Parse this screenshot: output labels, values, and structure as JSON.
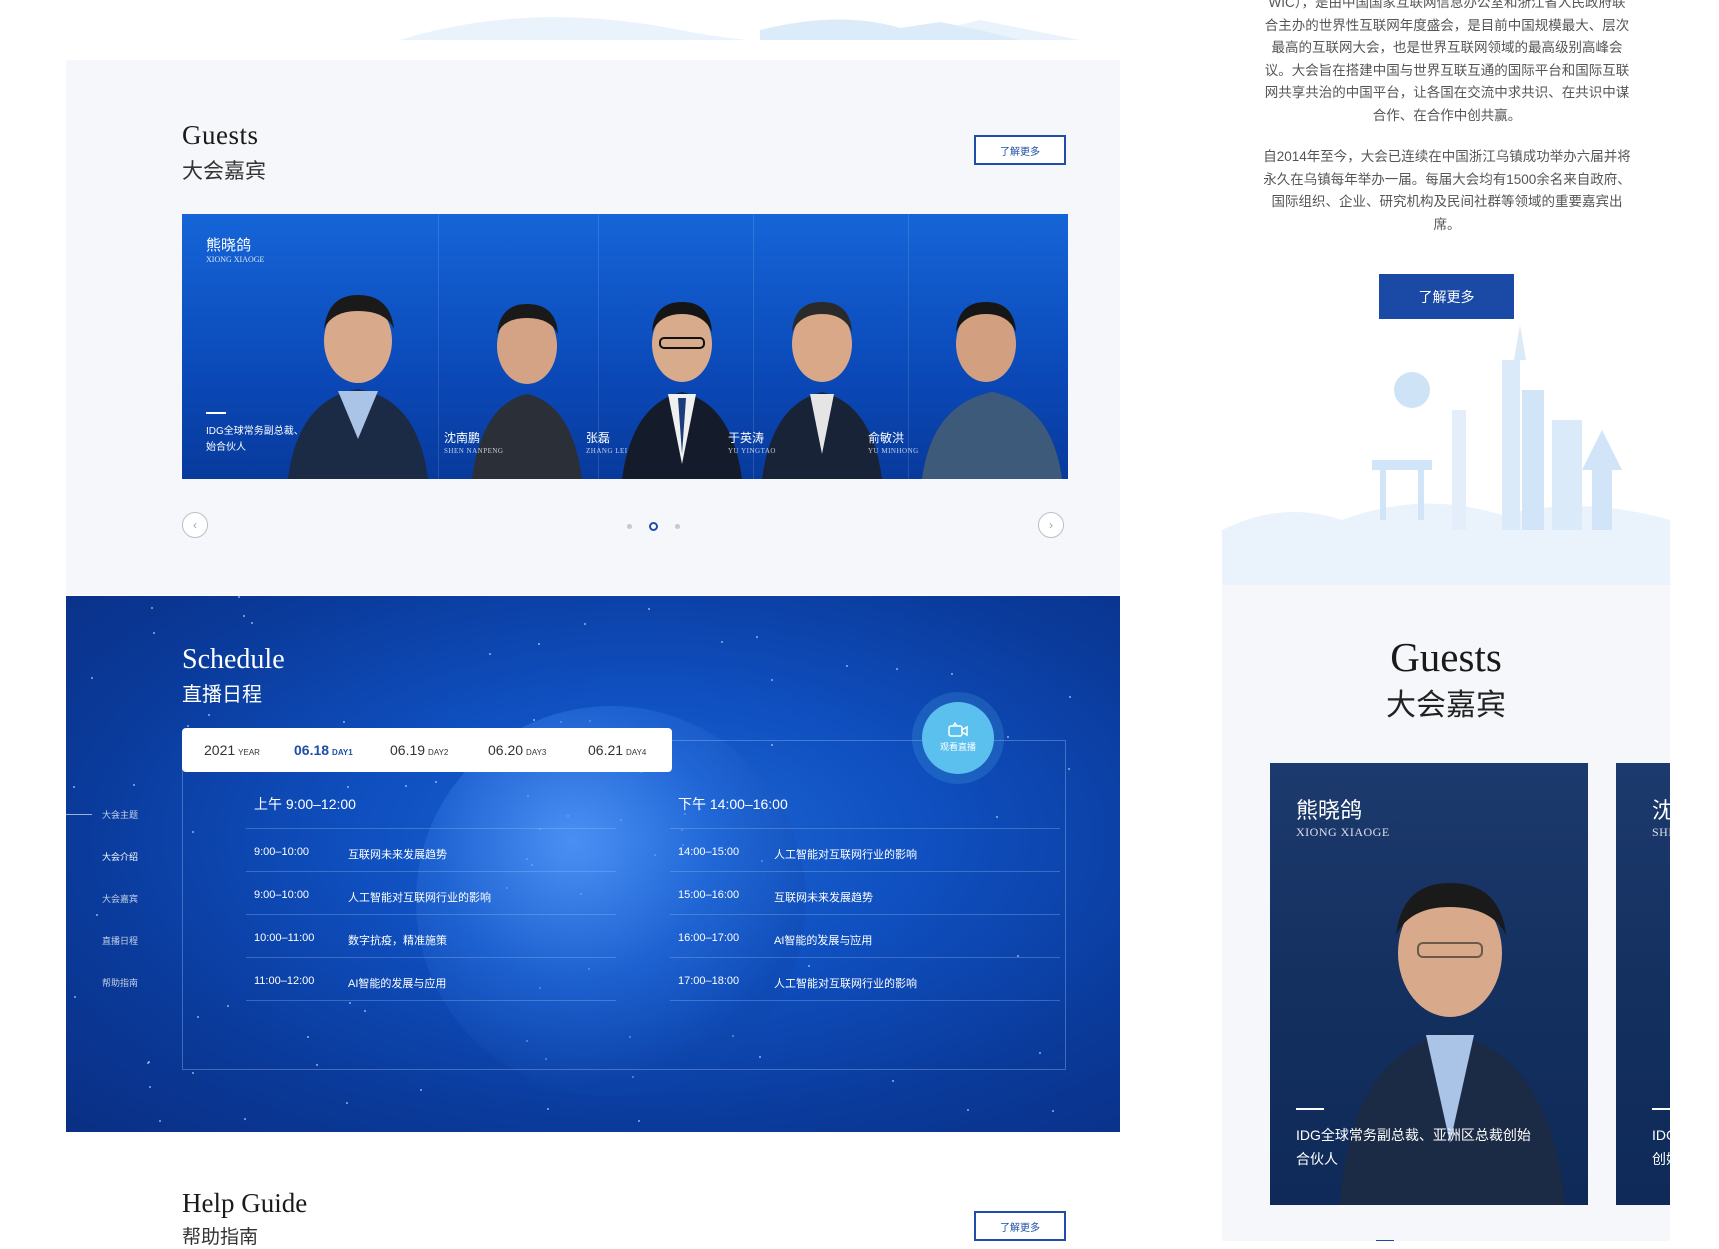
{
  "desktop": {
    "guests": {
      "title_en": "Guests",
      "title_cn": "大会嘉宾",
      "more_label": "了解更多",
      "lead": {
        "name": "熊晓鸽",
        "pinyin": "XIONG XIAOGE",
        "desc": "IDG全球常务副总裁、亚洲区总裁、创始合伙人"
      },
      "people": [
        {
          "name": "沈南鹏",
          "pinyin": "SHEN NANPENG"
        },
        {
          "name": "张磊",
          "pinyin": "ZHANG LEI"
        },
        {
          "name": "于英涛",
          "pinyin": "YU YINGTAO"
        },
        {
          "name": "俞敏洪",
          "pinyin": "YU MINHONG"
        }
      ],
      "prev_icon": "‹",
      "next_icon": "›",
      "carousel_active_index": 1,
      "carousel_total": 3
    },
    "schedule": {
      "title_en": "Schedule",
      "title_cn": "直播日程",
      "side_nav": [
        "大会主题",
        "大会介绍",
        "大会嘉宾",
        "直播日程",
        "帮助指南"
      ],
      "side_nav_active": "大会介绍",
      "dates": [
        {
          "main": "2021",
          "sub": "YEAR"
        },
        {
          "main": "06.18",
          "sub": "DAY1"
        },
        {
          "main": "06.19",
          "sub": "DAY2"
        },
        {
          "main": "06.20",
          "sub": "DAY3"
        },
        {
          "main": "06.21",
          "sub": "DAY4"
        }
      ],
      "active_date": "06.18",
      "live_label": "观看直播",
      "morning": {
        "label": "上午 9:00–12:00",
        "items": [
          {
            "time": "9:00–10:00",
            "topic": "互联网未来发展趋势"
          },
          {
            "time": "9:00–10:00",
            "topic": "人工智能对互联网行业的影响"
          },
          {
            "time": "10:00–11:00",
            "topic": "数字抗疫，精准施策"
          },
          {
            "time": "11:00–12:00",
            "topic": "AI智能的发展与应用"
          }
        ]
      },
      "afternoon": {
        "label": "下午 14:00–16:00",
        "items": [
          {
            "time": "14:00–15:00",
            "topic": "人工智能对互联网行业的影响"
          },
          {
            "time": "15:00–16:00",
            "topic": "互联网未来发展趋势"
          },
          {
            "time": "16:00–17:00",
            "topic": "AI智能的发展与应用"
          },
          {
            "time": "17:00–18:00",
            "topic": "人工智能对互联网行业的影响"
          }
        ]
      }
    },
    "help": {
      "title_en": "Help Guide",
      "title_cn": "帮助指南",
      "more_label": "了解更多"
    }
  },
  "mobile": {
    "intro_p1": "WIC），是由中国国家互联网信息办公室和浙江省人民政府联合主办的世界性互联网年度盛会，是目前中国规模最大、层次最高的互联网大会，也是世界互联网领域的最高级别高峰会议。大会旨在搭建中国与世界互联互通的国际平台和国际互联网共享共治的中国平台，让各国在交流中求共识、在共识中谋合作、在合作中创共赢。",
    "intro_p2": "自2014年至今，大会已连续在中国浙江乌镇成功举办六届并将永久在乌镇每年举办一届。每届大会均有1500余名来自政府、国际组织、企业、研究机构及民间社群等领域的重要嘉宾出席。",
    "more_label": "了解更多",
    "guests_title_en": "Guests",
    "guests_title_cn": "大会嘉宾",
    "card": {
      "name": "熊晓鸽",
      "pinyin": "XIONG XIAOGE",
      "desc": "IDG全球常务副总裁、亚洲区总裁创始合伙人"
    },
    "card_next": {
      "name": "沈",
      "pinyin": "SHE",
      "desc": "IDG 创始"
    },
    "progress": 0.13
  },
  "colors": {
    "brand_blue": "#1a4aa6",
    "schedule_blue": "#0f4fbf",
    "live_button": "#5cc0ef",
    "panel_gray": "#f5f7fa"
  }
}
